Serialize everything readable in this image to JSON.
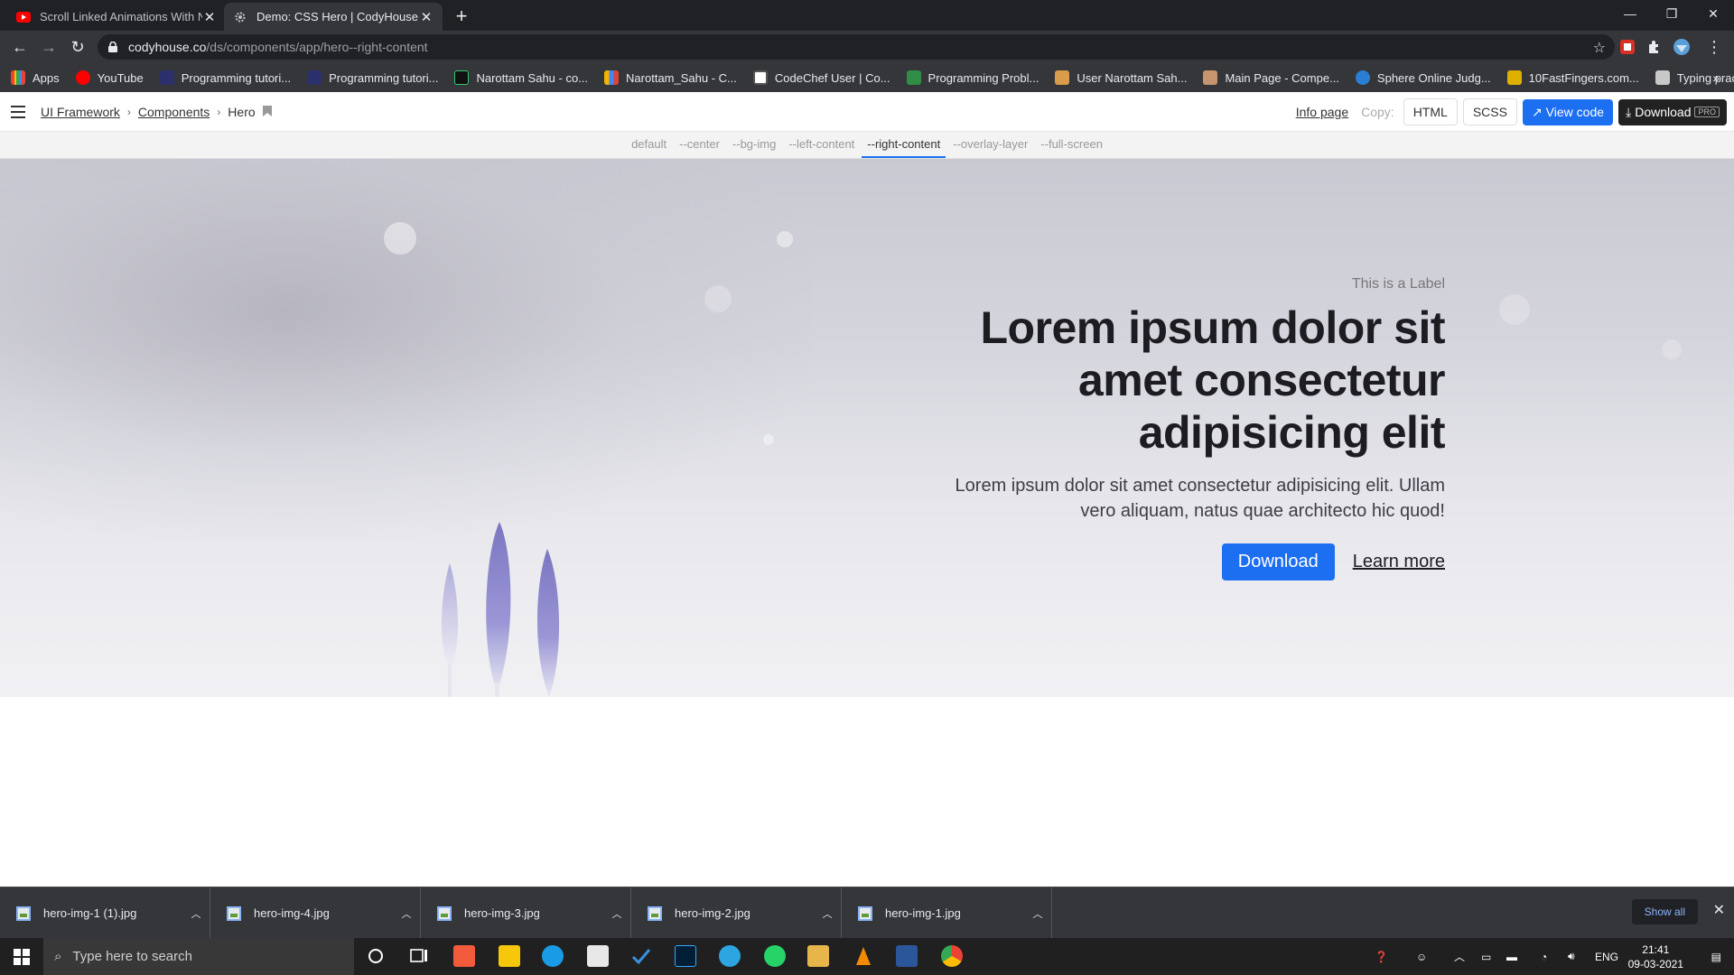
{
  "browser": {
    "tabs": [
      {
        "title": "Scroll Linked Animations With N",
        "active": false
      },
      {
        "title": "Demo: CSS Hero | CodyHouse",
        "active": true
      }
    ],
    "url_host": "codyhouse.co",
    "url_path": "/ds/components/app/hero--right-content",
    "bookmarks": [
      "Apps",
      "YouTube",
      "Programming tutori...",
      "Programming tutori...",
      "Narottam Sahu - co...",
      "Narottam_Sahu - C...",
      "CodeChef User | Co...",
      "Programming Probl...",
      "User Narottam Sah...",
      "Main Page - Compe...",
      "Sphere Online Judg...",
      "10FastFingers.com...",
      "Typing practice"
    ]
  },
  "header": {
    "breadcrumb": [
      "UI Framework",
      "Components",
      "Hero"
    ],
    "info_page": "Info page",
    "copy_label": "Copy:",
    "html_btn": "HTML",
    "scss_btn": "SCSS",
    "view_code": "View code",
    "download": "Download",
    "pro_badge": "PRO"
  },
  "variants": [
    "default",
    "--center",
    "--bg-img",
    "--left-content",
    "--right-content",
    "--overlay-layer",
    "--full-screen"
  ],
  "active_variant": "--right-content",
  "hero": {
    "label": "This is a Label",
    "title_lines": [
      "Lorem ipsum dolor sit",
      "amet consectetur",
      "adipisicing elit"
    ],
    "text_lines": [
      "Lorem ipsum dolor sit amet consectetur adipisicing elit. Ullam",
      "vero aliquam, natus quae architecto hic quod!"
    ],
    "primary_btn": "Download",
    "link": "Learn more"
  },
  "downloads": {
    "files": [
      "hero-img-1 (1).jpg",
      "hero-img-4.jpg",
      "hero-img-3.jpg",
      "hero-img-2.jpg",
      "hero-img-1.jpg"
    ],
    "show_all": "Show all"
  },
  "taskbar": {
    "search_placeholder": "Type here to search",
    "language": "ENG",
    "time": "21:41",
    "date": "09-03-2021"
  },
  "colors": {
    "accent": "#1d6ff2",
    "chrome_dark": "#202124",
    "chrome_mid": "#35363a"
  }
}
